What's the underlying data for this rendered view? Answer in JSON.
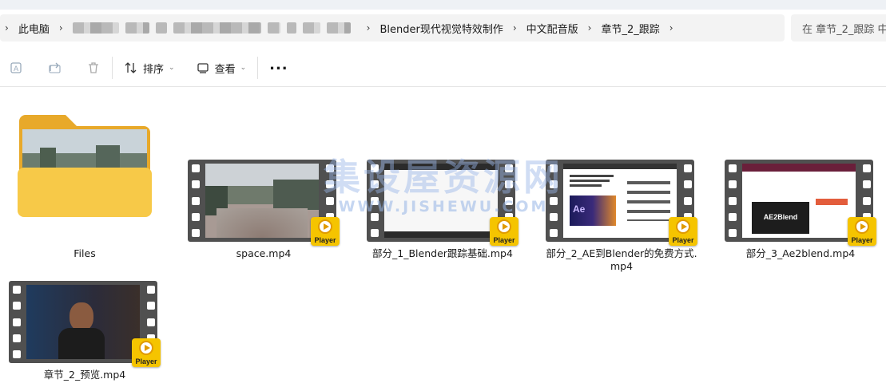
{
  "address_bar": {
    "root": "此电脑",
    "crumbs": [
      "Blender现代视觉特效制作",
      "中文配音版",
      "章节_2_跟踪"
    ]
  },
  "search": {
    "placeholder": "在 章节_2_跟踪 中"
  },
  "toolbar": {
    "sort_label": "排序",
    "view_label": "查看",
    "more_label": "..."
  },
  "items": [
    {
      "name": "Files",
      "type": "folder"
    },
    {
      "name": "space.mp4",
      "type": "video",
      "badge": "Player"
    },
    {
      "name": "部分_1_Blender跟踪基础.mp4",
      "type": "video",
      "badge": "Player"
    },
    {
      "name_line1": "部分_2_AE到Blender的免费方式.",
      "name_line2": "mp4",
      "type": "video",
      "badge": "Player"
    },
    {
      "name": "部分_3_Ae2blend.mp4",
      "type": "video",
      "badge": "Player"
    },
    {
      "name": "章节_2_预览.mp4",
      "type": "video",
      "badge": "Player"
    }
  ],
  "thumb_text": {
    "ae2blend": "AE2Blend",
    "ae": "Ae"
  },
  "watermark": {
    "line1": "集设屋资源网",
    "line2": "WWW.JISHEWU.COM"
  },
  "colors": {
    "badge": "#f5c400",
    "folder": "#f7c948",
    "film": "#505050"
  }
}
